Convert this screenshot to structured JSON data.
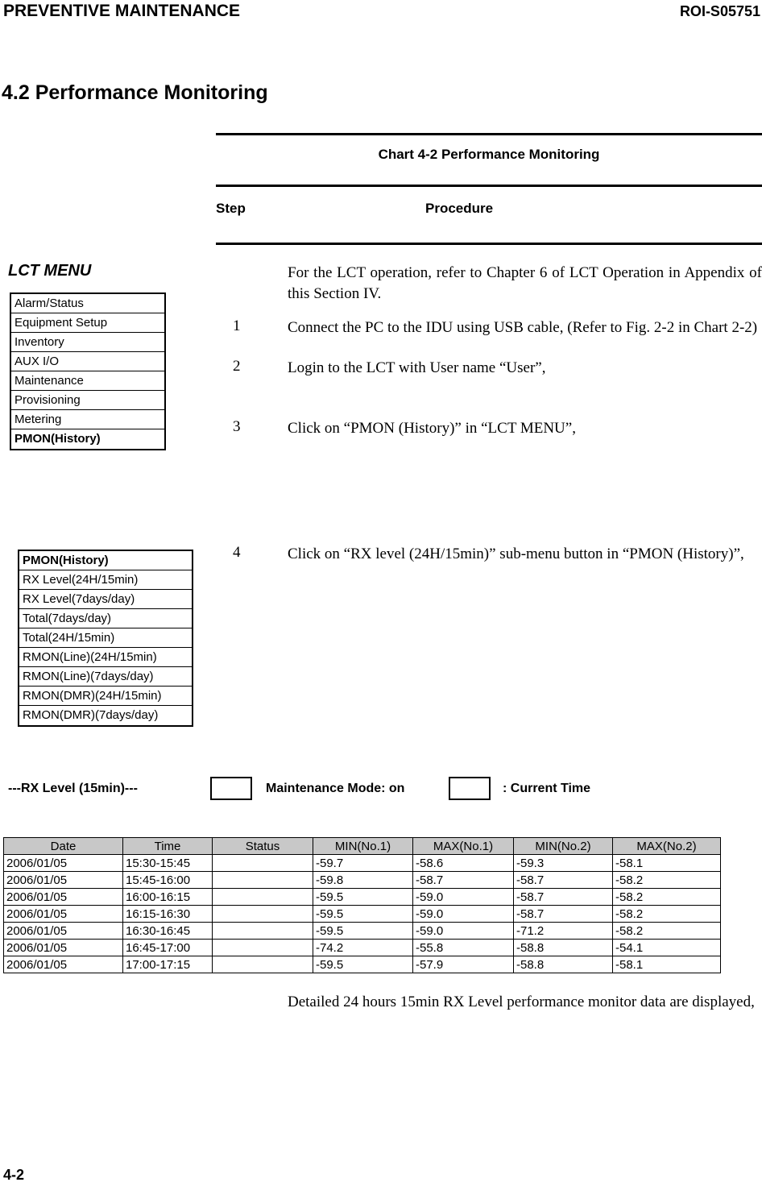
{
  "header": {
    "running_head": "PREVENTIVE MAINTENANCE",
    "doc_number": "ROI-S05751"
  },
  "section": {
    "title": "4.2  Performance Monitoring"
  },
  "chart": {
    "caption": "Chart 4-2  Performance Monitoring",
    "col_step": "Step",
    "col_procedure": "Procedure"
  },
  "lct_menu": {
    "title": "LCT MENU",
    "items": [
      {
        "label": "Alarm/Status",
        "selected": false
      },
      {
        "label": "Equipment Setup",
        "selected": false
      },
      {
        "label": "Inventory",
        "selected": false
      },
      {
        "label": "AUX I/O",
        "selected": false
      },
      {
        "label": "Maintenance",
        "selected": false
      },
      {
        "label": "Provisioning",
        "selected": false
      },
      {
        "label": "Metering",
        "selected": false
      },
      {
        "label": "PMON(History)",
        "selected": true
      }
    ]
  },
  "pmon_menu": {
    "items": [
      {
        "label": "PMON(History)",
        "selected": true
      },
      {
        "label": "RX Level(24H/15min)",
        "selected": false
      },
      {
        "label": "RX Level(7days/day)",
        "selected": false
      },
      {
        "label": "Total(7days/day)",
        "selected": false
      },
      {
        "label": "Total(24H/15min)",
        "selected": false
      },
      {
        "label": "RMON(Line)(24H/15min)",
        "selected": false
      },
      {
        "label": "RMON(Line)(7days/day)",
        "selected": false
      },
      {
        "label": "RMON(DMR)(24H/15min)",
        "selected": false
      },
      {
        "label": "RMON(DMR)(7days/day)",
        "selected": false
      }
    ]
  },
  "procedure": {
    "intro": "For the LCT operation, refer to Chapter 6 of LCT Operation in Appendix of this Section IV.",
    "step1_num": "1",
    "step1_text": "Connect the PC to the IDU using USB cable, (Refer to Fig. 2-2 in Chart 2-2)",
    "step2_num": "2",
    "step2_text": "Login to the LCT with User name “User”,",
    "step3_num": "3",
    "step3_text": "Click on “PMON (History)” in “LCT MENU”,",
    "step4_num": "4",
    "step4_text": "Click on “RX level (24H/15min)” sub-menu button in “PMON (History)”,",
    "step5_text": "Detailed 24 hours 15min RX Level performance monitor data are displayed,"
  },
  "screen": {
    "title": "---RX Level (15min)---",
    "maintenance_mode_label": "Maintenance Mode: on",
    "current_time_label": ": Current Time",
    "field_1_value": "",
    "field_2_value": "",
    "header_bg": "#c8c8c8"
  },
  "pm_table": {
    "columns": [
      "Date",
      "Time",
      "Status",
      "MIN(No.1)",
      "MAX(No.1)",
      "MIN(No.2)",
      "MAX(No.2)"
    ],
    "rows": [
      [
        "2006/01/05",
        "15:30-15:45",
        "",
        "-59.7",
        "-58.6",
        "-59.3",
        "-58.1"
      ],
      [
        "2006/01/05",
        "15:45-16:00",
        "",
        "-59.8",
        "-58.7",
        "-58.7",
        "-58.2"
      ],
      [
        "2006/01/05",
        "16:00-16:15",
        "",
        "-59.5",
        "-59.0",
        "-58.7",
        "-58.2"
      ],
      [
        "2006/01/05",
        "16:15-16:30",
        "",
        "-59.5",
        "-59.0",
        "-58.7",
        "-58.2"
      ],
      [
        "2006/01/05",
        "16:30-16:45",
        "",
        "-59.5",
        "-59.0",
        "-71.2",
        "-58.2"
      ],
      [
        "2006/01/05",
        "16:45-17:00",
        "",
        "-74.2",
        "-55.8",
        "-58.8",
        "-54.1"
      ],
      [
        "2006/01/05",
        "17:00-17:15",
        "",
        "-59.5",
        "-57.9",
        "-58.8",
        "-58.1"
      ]
    ]
  },
  "footer": {
    "page_number": "4-2"
  }
}
